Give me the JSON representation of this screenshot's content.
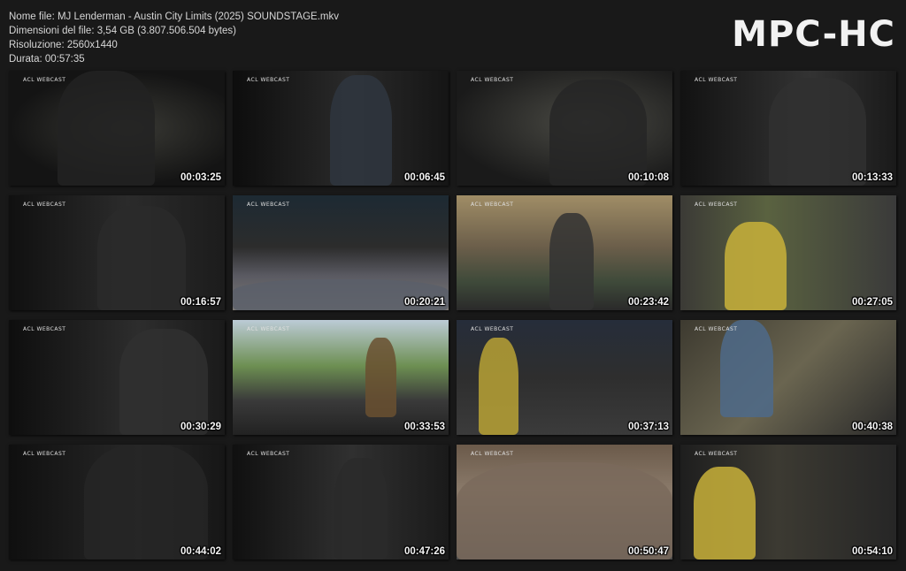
{
  "file_info": {
    "name_line": "Nome file: MJ Lenderman - Austin City Limits (2025) SOUNDSTAGE.mkv",
    "size_line": "Dimensioni del file: 3,54 GB (3.807.506.504 bytes)",
    "resolution_line": "Risoluzione: 2560x1440",
    "duration_line": "Durata: 00:57:35"
  },
  "logo": "MPC-HC",
  "watermark": "ACL WEBCAST",
  "thumbnails": [
    {
      "timecode": "00:03:25"
    },
    {
      "timecode": "00:06:45"
    },
    {
      "timecode": "00:10:08"
    },
    {
      "timecode": "00:13:33"
    },
    {
      "timecode": "00:16:57"
    },
    {
      "timecode": "00:20:21"
    },
    {
      "timecode": "00:23:42"
    },
    {
      "timecode": "00:27:05"
    },
    {
      "timecode": "00:30:29"
    },
    {
      "timecode": "00:33:53"
    },
    {
      "timecode": "00:37:13"
    },
    {
      "timecode": "00:40:38"
    },
    {
      "timecode": "00:44:02"
    },
    {
      "timecode": "00:47:26"
    },
    {
      "timecode": "00:50:47"
    },
    {
      "timecode": "00:54:10"
    }
  ]
}
